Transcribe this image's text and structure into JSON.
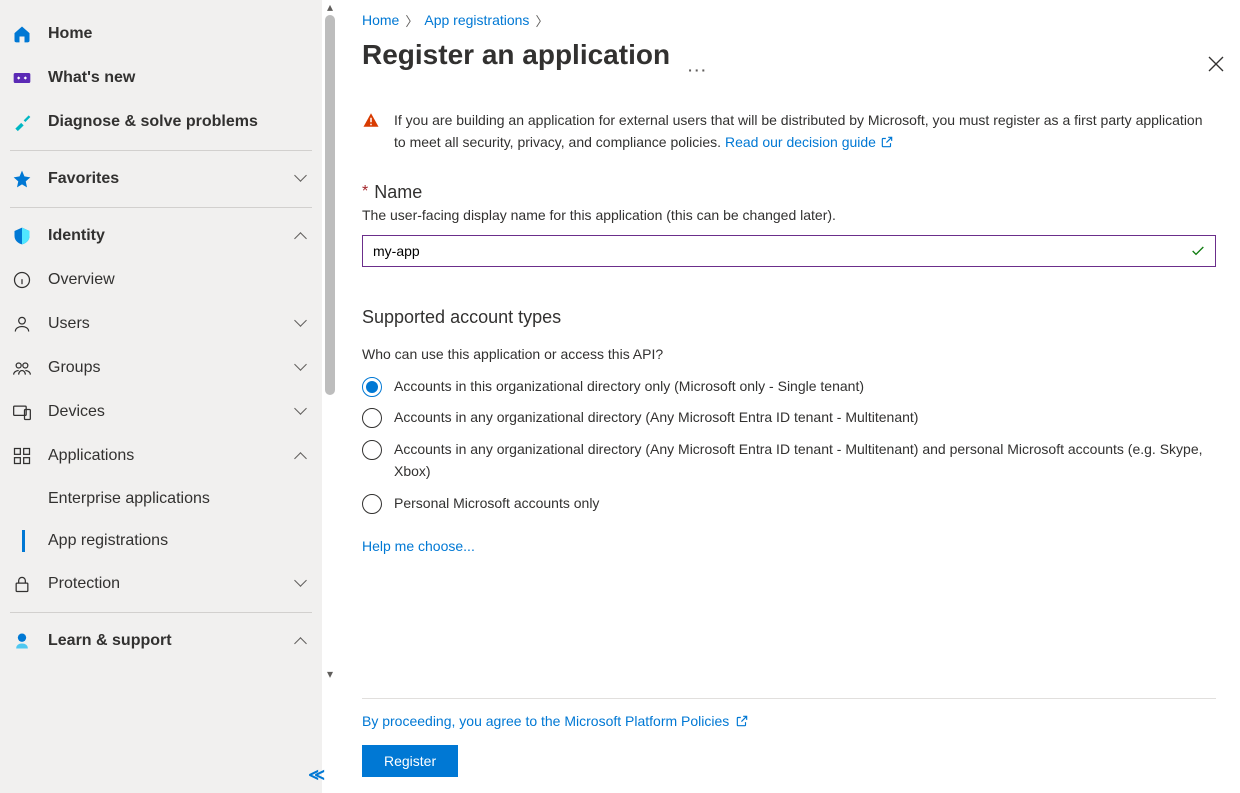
{
  "sidebar": {
    "home": "Home",
    "whats_new": "What's new",
    "diagnose": "Diagnose & solve problems",
    "favorites": "Favorites",
    "identity": "Identity",
    "overview": "Overview",
    "users": "Users",
    "groups": "Groups",
    "devices": "Devices",
    "applications": "Applications",
    "enterprise_apps": "Enterprise applications",
    "app_registrations": "App registrations",
    "protection": "Protection",
    "learn_support": "Learn & support"
  },
  "breadcrumbs": {
    "home": "Home",
    "app_regs": "App registrations"
  },
  "page": {
    "title": "Register an application",
    "warning_text": "If you are building an application for external users that will be distributed by Microsoft, you must register as a first party application to meet all security, privacy, and compliance policies. ",
    "warning_link": "Read our decision guide",
    "name_label": "Name",
    "name_help": "The user-facing display name for this application (this can be changed later).",
    "name_value": "my-app",
    "account_types_heading": "Supported account types",
    "account_types_question": "Who can use this application or access this API?",
    "radio_options": [
      "Accounts in this organizational directory only (Microsoft only - Single tenant)",
      "Accounts in any organizational directory (Any Microsoft Entra ID tenant - Multitenant)",
      "Accounts in any organizational directory (Any Microsoft Entra ID tenant - Multitenant) and personal Microsoft accounts (e.g. Skype, Xbox)",
      "Personal Microsoft accounts only"
    ],
    "help_me_choose": "Help me choose...",
    "policies_text": "By proceeding, you agree to the Microsoft Platform Policies",
    "register_button": "Register"
  },
  "colors": {
    "accent": "#0078d4"
  }
}
